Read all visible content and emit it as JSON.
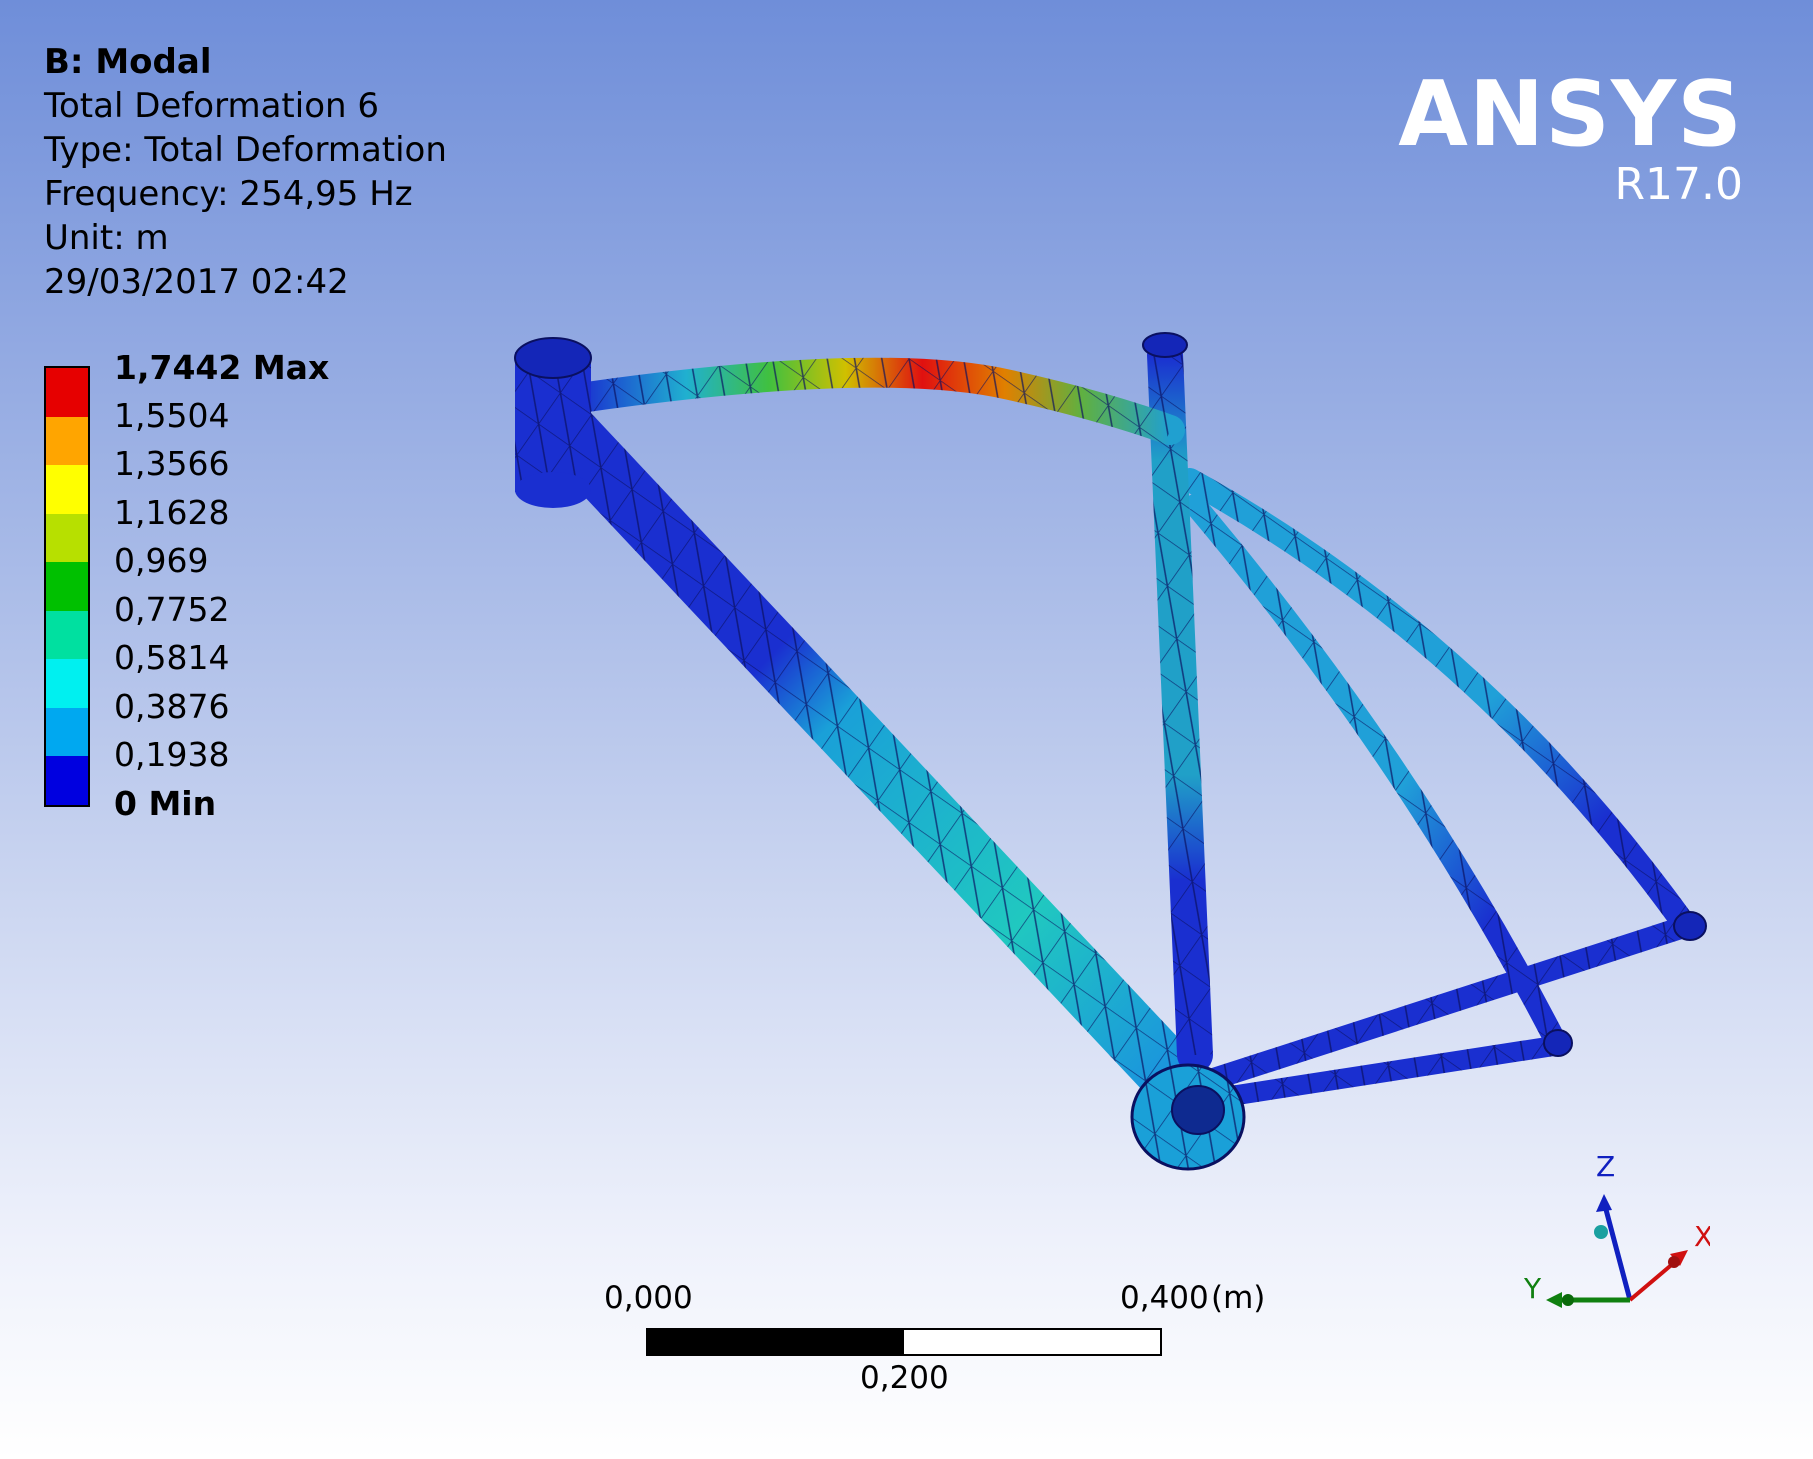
{
  "header": {
    "system": "B: Modal",
    "result": "Total Deformation 6",
    "type": "Type: Total Deformation",
    "frequency": "Frequency: 254,95 Hz",
    "unit": "Unit: m",
    "datetime": "29/03/2017 02:42"
  },
  "logo": {
    "brand": "ANSYS",
    "version": "R17.0"
  },
  "legend": {
    "labels": [
      "1,7442 Max",
      "1,5504",
      "1,3566",
      "1,1628",
      "0,969",
      "0,7752",
      "0,5814",
      "0,3876",
      "0,1938",
      "0 Min"
    ],
    "colors": [
      "#e60000",
      "#ffa500",
      "#ffff00",
      "#b7e000",
      "#00c000",
      "#00e0a0",
      "#00f0f0",
      "#00a8f0",
      "#0000e0"
    ]
  },
  "scale_bar": {
    "left": "0,000",
    "mid": "0,200",
    "right": "0,400",
    "unit": "(m)"
  },
  "triad": {
    "x": "X",
    "y": "Y",
    "z": "Z"
  },
  "colors": {
    "background_top": "#6f8ed9",
    "background_bottom": "#ffffff",
    "mesh_low": "#1a2fd0",
    "mesh_mid": "#2ab8d8"
  },
  "icons": [
    "coordinate-triad-icon"
  ]
}
